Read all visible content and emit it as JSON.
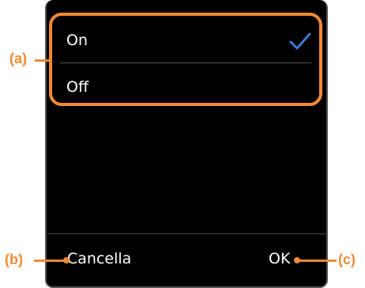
{
  "options": {
    "on_label": "On",
    "off_label": "Off",
    "selected": "On"
  },
  "softkeys": {
    "left_label": "Cancella",
    "right_label": "OK"
  },
  "callouts": {
    "a": "(a)",
    "b": "(b)",
    "c": "(c)"
  },
  "colors": {
    "accent": "#f08a32",
    "check": "#3a7bd5",
    "screen_bg": "#000000"
  },
  "icons": {
    "selected_marker": "check-icon"
  }
}
